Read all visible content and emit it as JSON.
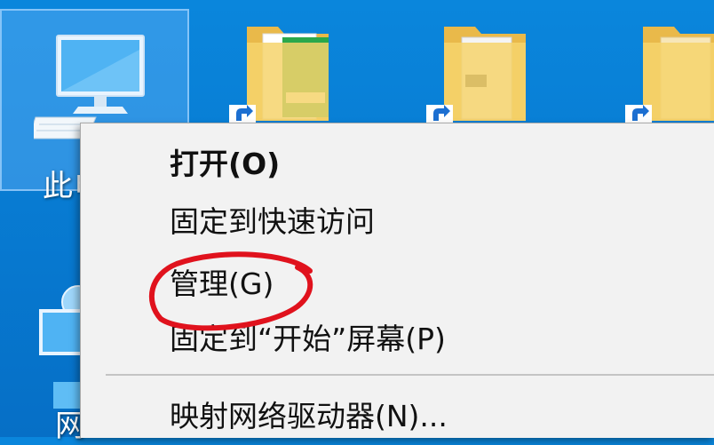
{
  "desktop": {
    "this_pc_label": "此电",
    "network_label": "网"
  },
  "context_menu": {
    "items": [
      {
        "label": "打开(O)",
        "bold": true
      },
      {
        "label": "固定到快速访问"
      },
      {
        "label": "管理(G)"
      },
      {
        "label": "固定到“开始”屏幕(P)"
      },
      {
        "label": "映射网络驱动器(N)..."
      }
    ],
    "highlighted_item": "管理(G)"
  },
  "colors": {
    "desktop_bg": "#0778cf",
    "menu_bg": "#f2f2f2",
    "annotation_red": "#e0121d"
  },
  "icons": [
    "this-pc-icon",
    "folder-icon",
    "shortcut-arrow-icon",
    "network-icon"
  ]
}
